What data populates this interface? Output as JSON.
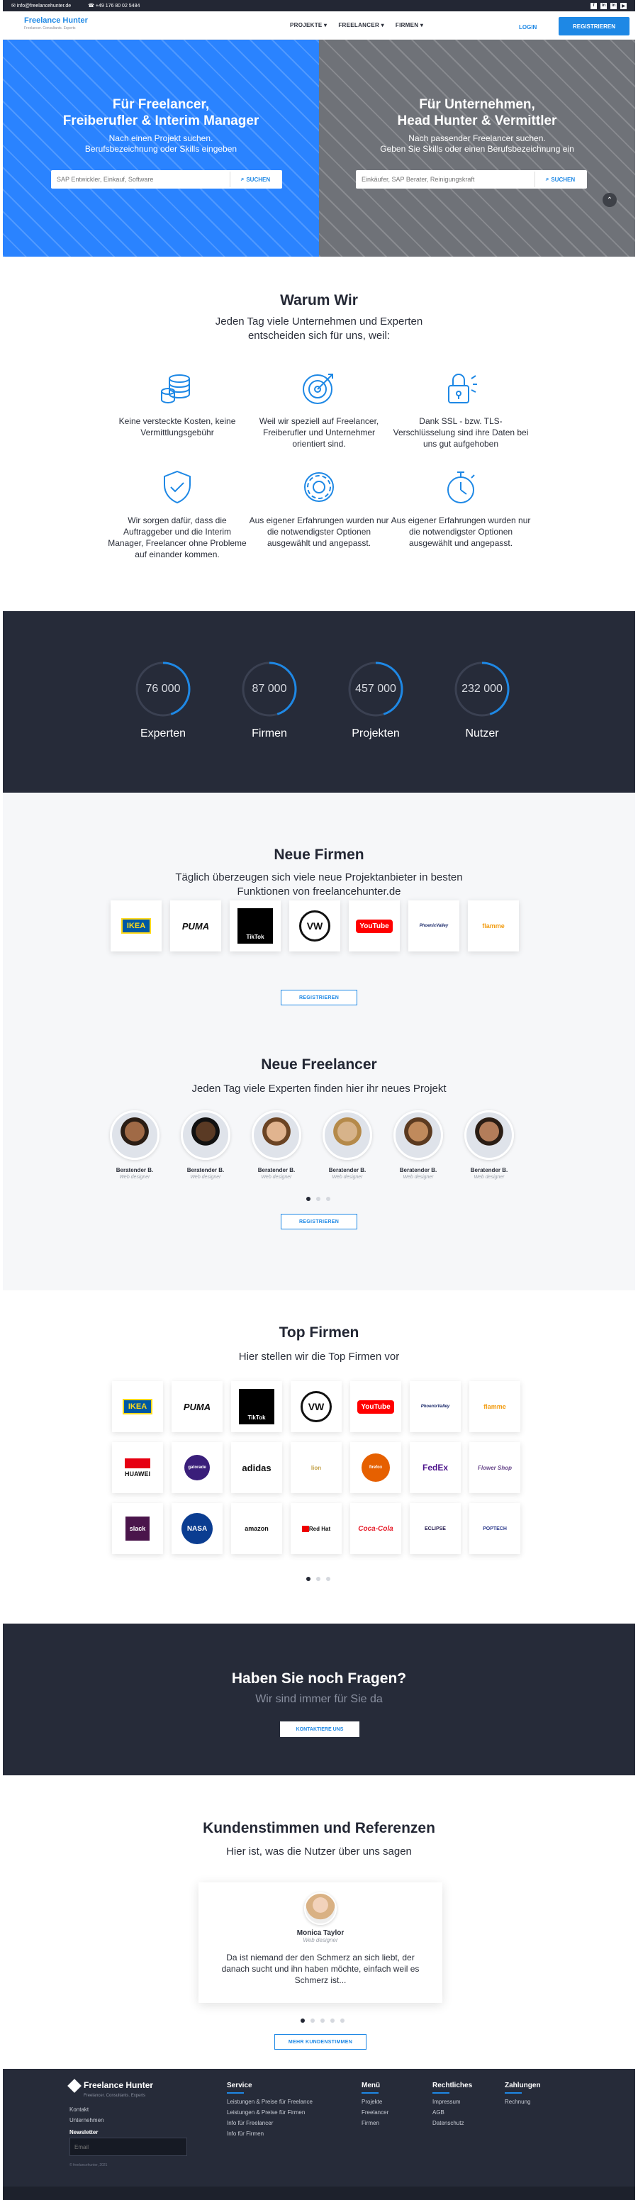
{
  "topbar": {
    "email": "info@freelancehunter.de",
    "phone": "+49 176 80 02 5484",
    "social": [
      "f",
      "in",
      "in",
      "▶"
    ]
  },
  "nav": {
    "logo": "Freelance Hunter",
    "logo_tagline": "Freelancer. Consultants. Experts",
    "menu": [
      "PROJEKTE",
      "FREELANCER",
      "FIRMEN"
    ],
    "login": "LOGIN",
    "register": "REGISTRIEREN"
  },
  "hero": {
    "left": {
      "title_1": "Für Freelancer,",
      "title_2": "Freiberufler & Interim Manager",
      "sub_1": "Nach einen Projekt suchen.",
      "sub_2": "Berufsbezeichnung oder Skills eingeben",
      "placeholder": "SAP Entwickler, Einkauf, Software",
      "button": "SUCHEN"
    },
    "right": {
      "title_1": "Für Unternehmen,",
      "title_2": "Head Hunter & Vermittler",
      "sub_1": "Nach passender Freelancer suchen.",
      "sub_2": "Geben Sie Skills oder einen Berufsbezeichnung ein",
      "placeholder": "Einkäufer, SAP Berater, Reinigungskraft",
      "button": "SUCHEN"
    }
  },
  "warum": {
    "title": "Warum Wir",
    "sub_1": "Jeden Tag viele Unternehmen und Experten",
    "sub_2": "entscheiden sich für uns, weil:",
    "features": [
      {
        "icon": "coins-icon",
        "text": "Keine versteckte Kosten, keine Vermittlungsgebühr"
      },
      {
        "icon": "target-icon",
        "text": "Weil wir speziell auf Freelancer, Freiberufler und Unternehmer orientiert sind."
      },
      {
        "icon": "lock-icon",
        "text": "Dank SSL - bzw. TLS-Verschlüsselung sind ihre Daten bei uns gut aufgehoben"
      },
      {
        "icon": "shield-check-icon",
        "text": "Wir sorgen dafür, dass die Auftraggeber und die Interim Manager, Freelancer ohne Probleme auf einander kommen."
      },
      {
        "icon": "gear-icon",
        "text": "Aus eigener Erfahrungen wurden nur die notwendigster Optionen ausgewählt und angepasst."
      },
      {
        "icon": "stopwatch-icon",
        "text": "Aus eigener Erfahrungen wurden nur die notwendigster Optionen ausgewählt und angepasst."
      }
    ]
  },
  "stats": [
    {
      "value": "76 000",
      "label": "Experten",
      "fill": 0.45
    },
    {
      "value": "87 000",
      "label": "Firmen",
      "fill": 0.45
    },
    {
      "value": "457 000",
      "label": "Projekten",
      "fill": 0.45
    },
    {
      "value": "232 000",
      "label": "Nutzer",
      "fill": 0.45
    }
  ],
  "neue_firmen": {
    "title": "Neue Firmen",
    "sub_1": "Täglich überzeugen sich viele neue Projektanbieter in besten",
    "sub_2": "Funktionen von freelancehunter.de",
    "logos": [
      "IKEA",
      "PUMA",
      "TikTok",
      "VW",
      "YouTube",
      "PhoenixValley",
      "flamme"
    ],
    "button": "REGISTRIEREN"
  },
  "neue_freelancer": {
    "title": "Neue Freelancer",
    "sub": "Jeden Tag viele Experten finden hier ihr neues Projekt",
    "people": [
      {
        "name": "Beratender B.",
        "role": "Web designer"
      },
      {
        "name": "Beratender B.",
        "role": "Web designer"
      },
      {
        "name": "Beratender B.",
        "role": "Web designer"
      },
      {
        "name": "Beratender B.",
        "role": "Web designer"
      },
      {
        "name": "Beratender B.",
        "role": "Web designer"
      },
      {
        "name": "Beratender B.",
        "role": "Web designer"
      }
    ],
    "button": "REGISTRIEREN"
  },
  "top_firmen": {
    "title": "Top Firmen",
    "sub": "Hier stellen wir die Top Firmen vor",
    "row1": [
      "IKEA",
      "PUMA",
      "TikTok",
      "VW",
      "YouTube",
      "PhoenixValley",
      "flamme"
    ],
    "row2": [
      "HUAWEI",
      "gatorade",
      "adidas",
      "lion",
      "firefox",
      "FedEx",
      "Flower Shop"
    ],
    "row3": [
      "slack",
      "NASA",
      "amazon",
      "Red Hat",
      "Coca-Cola",
      "ECLIPSE",
      "POPTECH"
    ]
  },
  "cta": {
    "title": "Haben Sie noch Fragen?",
    "sub": "Wir sind immer für Sie da",
    "button": "KONTAKTIERE UNS"
  },
  "kunden": {
    "title": "Kundenstimmen und Referenzen",
    "sub": "Hier ist, was die Nutzer über uns sagen",
    "name": "Monica Taylor",
    "role": "Web designer",
    "quote": "Da ist niemand der den Schmerz an sich liebt, der danach sucht und ihn haben möchte, einfach weil es Schmerz ist...",
    "button": "MEHR KUNDENSTIMMEN"
  },
  "footer": {
    "logo": "Freelance Hunter",
    "tagline": "Freelancer. Consultants. Experts",
    "links": [
      "Kontakt",
      "Unternehmen"
    ],
    "newsletter": "Newsletter",
    "email_placeholder": "Email",
    "copyright": "© freelancehunter, 2021",
    "service": {
      "title": "Service",
      "items": [
        "Leistungen & Preise für Freelance",
        "Leistungen & Preise für Firmen",
        "Info für Freelancer",
        "Info für Firmen"
      ]
    },
    "menu": {
      "title": "Menü",
      "items": [
        "Projekte",
        "Freelancer",
        "Firmen"
      ]
    },
    "recht": {
      "title": "Rechtliches",
      "items": [
        "Impressum",
        "AGB",
        "Datenschutz"
      ]
    },
    "zahl": {
      "title": "Zahlungen",
      "items": [
        "Rechnung"
      ]
    }
  },
  "colors": {
    "accent": "#1e88e5",
    "dark": "#262b39",
    "hero_left": "#2a83ff",
    "hero_right": "#6f7278"
  }
}
